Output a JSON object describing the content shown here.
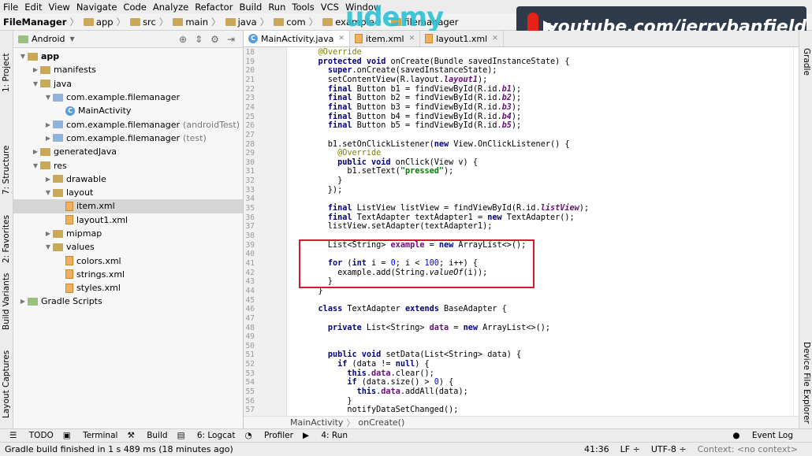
{
  "menu": [
    "File",
    "Edit",
    "View",
    "Navigate",
    "Code",
    "Analyze",
    "Refactor",
    "Build",
    "Run",
    "Tools",
    "VCS",
    "Window"
  ],
  "breadcrumbs": [
    "FileManager",
    "app",
    "src",
    "main",
    "java",
    "com",
    "example",
    "filemanager"
  ],
  "watermark": {
    "logo": "udemy",
    "channel": "youtube.com/jerrybanfield"
  },
  "project": {
    "view": "Android",
    "tree": [
      {
        "label": "app",
        "depth": 0,
        "kind": "module",
        "bold": true
      },
      {
        "label": "manifests",
        "depth": 1,
        "kind": "folder"
      },
      {
        "label": "java",
        "depth": 1,
        "kind": "folder"
      },
      {
        "label": "com.example.filemanager",
        "depth": 2,
        "kind": "pkg"
      },
      {
        "label": "MainActivity",
        "depth": 3,
        "kind": "class"
      },
      {
        "label": "com.example.filemanager",
        "suffix": "(androidTest)",
        "depth": 2,
        "kind": "pkg"
      },
      {
        "label": "com.example.filemanager",
        "suffix": "(test)",
        "depth": 2,
        "kind": "pkg"
      },
      {
        "label": "generatedJava",
        "depth": 1,
        "kind": "folder"
      },
      {
        "label": "res",
        "depth": 1,
        "kind": "folder"
      },
      {
        "label": "drawable",
        "depth": 2,
        "kind": "folder"
      },
      {
        "label": "layout",
        "depth": 2,
        "kind": "folder"
      },
      {
        "label": "item.xml",
        "depth": 3,
        "kind": "xml",
        "selected": true
      },
      {
        "label": "layout1.xml",
        "depth": 3,
        "kind": "xml"
      },
      {
        "label": "mipmap",
        "depth": 2,
        "kind": "folder"
      },
      {
        "label": "values",
        "depth": 2,
        "kind": "folder"
      },
      {
        "label": "colors.xml",
        "depth": 3,
        "kind": "xml"
      },
      {
        "label": "strings.xml",
        "depth": 3,
        "kind": "xml"
      },
      {
        "label": "styles.xml",
        "depth": 3,
        "kind": "xml"
      },
      {
        "label": "Gradle Scripts",
        "depth": 0,
        "kind": "gradle"
      }
    ]
  },
  "tabs": [
    "MainActivity.java",
    "item.xml",
    "layout1.xml"
  ],
  "left_tabs": [
    "1: Project",
    "7: Structure",
    "2: Favorites",
    "Build Variants",
    "Layout Captures"
  ],
  "right_tabs": [
    "Gradle",
    "Device File Explorer"
  ],
  "code_lines": [
    {
      "n": "18",
      "html": "    <span class='an'>@Override</span>"
    },
    {
      "n": "19",
      "html": "    <span class='kw'>protected void</span> onCreate(Bundle savedInstanceState) {"
    },
    {
      "n": "20",
      "html": "      <span class='kw'>super</span>.onCreate(savedInstanceState);"
    },
    {
      "n": "21",
      "html": "      setContentView(R.layout.<span class='fd it'>layout1</span>);"
    },
    {
      "n": "22",
      "html": "      <span class='kw'>final</span> Button b1 = findViewById(R.id.<span class='fd it'>b1</span>);"
    },
    {
      "n": "23",
      "html": "      <span class='kw'>final</span> Button b2 = findViewById(R.id.<span class='fd it'>b2</span>);"
    },
    {
      "n": "24",
      "html": "      <span class='kw'>final</span> Button b3 = findViewById(R.id.<span class='fd it'>b3</span>);"
    },
    {
      "n": "25",
      "html": "      <span class='kw'>final</span> Button b4 = findViewById(R.id.<span class='fd it'>b4</span>);"
    },
    {
      "n": "26",
      "html": "      <span class='kw'>final</span> Button b5 = findViewById(R.id.<span class='fd it'>b5</span>);"
    },
    {
      "n": "27",
      "html": ""
    },
    {
      "n": "28",
      "html": "      b1.setOnClickListener(<span class='kw'>new</span> View.OnClickListener() {"
    },
    {
      "n": "29",
      "html": "        <span class='an'>@Override</span>"
    },
    {
      "n": "30",
      "html": "        <span class='kw'>public void</span> onClick(View v) {"
    },
    {
      "n": "31",
      "html": "          b1.setText(<span class='st'>\"pressed\"</span>);"
    },
    {
      "n": "32",
      "html": "        }"
    },
    {
      "n": "33",
      "html": "      });"
    },
    {
      "n": "34",
      "html": ""
    },
    {
      "n": "35",
      "html": "      <span class='kw'>final</span> ListView listView = findViewById(R.id.<span class='fd it'>listView</span>);"
    },
    {
      "n": "36",
      "html": "      <span class='kw'>final</span> TextAdapter textAdapter1 = <span class='kw'>new</span> TextAdapter();"
    },
    {
      "n": "37",
      "html": "      listView.setAdapter(textAdapter1);"
    },
    {
      "n": "38",
      "html": ""
    },
    {
      "n": "39",
      "html": "      List&lt;String&gt; <span class='fd'>example</span> = <span class='kw'>new</span> ArrayList&lt;&gt;();"
    },
    {
      "n": "40",
      "html": ""
    },
    {
      "n": "41",
      "html": "      <span class='kw'>for</span> (<span class='kw'>int</span> i = <span class='nm'>0</span>; i &lt; <span class='nm'>100</span>; i++) {"
    },
    {
      "n": "42",
      "html": "        example.add(String.<span class='it'>valueOf</span>(i));"
    },
    {
      "n": "43",
      "html": "      }"
    },
    {
      "n": "44",
      "html": "    }"
    },
    {
      "n": "45",
      "html": ""
    },
    {
      "n": "46",
      "html": "    <span class='kw'>class</span> TextAdapter <span class='kw'>extends</span> BaseAdapter {"
    },
    {
      "n": "47",
      "html": ""
    },
    {
      "n": "48",
      "html": "      <span class='kw'>private</span> List&lt;String&gt; <span class='fd'>data</span> = <span class='kw'>new</span> ArrayList&lt;&gt;();"
    },
    {
      "n": "49",
      "html": ""
    },
    {
      "n": "50",
      "html": ""
    },
    {
      "n": "51",
      "html": "      <span class='kw'>public void</span> setData(List&lt;String&gt; data) {"
    },
    {
      "n": "52",
      "html": "        <span class='kw'>if</span> (data != <span class='kw'>null</span>) {"
    },
    {
      "n": "53",
      "html": "          <span class='kw'>this</span>.<span class='fd'>data</span>.clear();"
    },
    {
      "n": "54",
      "html": "          <span class='kw'>if</span> (data.size() &gt; <span class='nm'>0</span>) {"
    },
    {
      "n": "55",
      "html": "            <span class='kw'>this</span>.<span class='fd'>data</span>.addAll(data);"
    },
    {
      "n": "56",
      "html": "          }"
    },
    {
      "n": "57",
      "html": "          notifyDataSetChanged();"
    }
  ],
  "editor_crumbs": [
    "MainActivity",
    "onCreate()"
  ],
  "toolwindows": [
    "TODO",
    "Terminal",
    "Build",
    "6: Logcat",
    "Profiler",
    "4: Run"
  ],
  "event_log": "Event Log",
  "status": {
    "message": "Gradle build finished in 1 s 489 ms (18 minutes ago)",
    "position": "41:36",
    "line_sep": "LF ÷",
    "encoding": "UTF-8 ÷",
    "context": "Context: <no context>"
  }
}
